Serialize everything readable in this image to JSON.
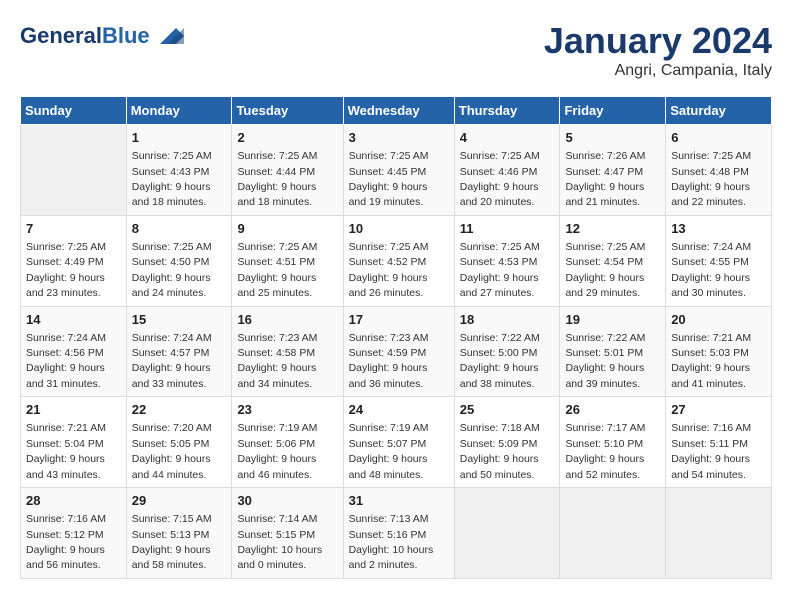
{
  "header": {
    "logo_line1": "General",
    "logo_line2": "Blue",
    "month": "January 2024",
    "location": "Angri, Campania, Italy"
  },
  "days_of_week": [
    "Sunday",
    "Monday",
    "Tuesday",
    "Wednesday",
    "Thursday",
    "Friday",
    "Saturday"
  ],
  "weeks": [
    [
      {
        "num": "",
        "info": ""
      },
      {
        "num": "1",
        "info": "Sunrise: 7:25 AM\nSunset: 4:43 PM\nDaylight: 9 hours\nand 18 minutes."
      },
      {
        "num": "2",
        "info": "Sunrise: 7:25 AM\nSunset: 4:44 PM\nDaylight: 9 hours\nand 18 minutes."
      },
      {
        "num": "3",
        "info": "Sunrise: 7:25 AM\nSunset: 4:45 PM\nDaylight: 9 hours\nand 19 minutes."
      },
      {
        "num": "4",
        "info": "Sunrise: 7:25 AM\nSunset: 4:46 PM\nDaylight: 9 hours\nand 20 minutes."
      },
      {
        "num": "5",
        "info": "Sunrise: 7:26 AM\nSunset: 4:47 PM\nDaylight: 9 hours\nand 21 minutes."
      },
      {
        "num": "6",
        "info": "Sunrise: 7:25 AM\nSunset: 4:48 PM\nDaylight: 9 hours\nand 22 minutes."
      }
    ],
    [
      {
        "num": "7",
        "info": "Sunrise: 7:25 AM\nSunset: 4:49 PM\nDaylight: 9 hours\nand 23 minutes."
      },
      {
        "num": "8",
        "info": "Sunrise: 7:25 AM\nSunset: 4:50 PM\nDaylight: 9 hours\nand 24 minutes."
      },
      {
        "num": "9",
        "info": "Sunrise: 7:25 AM\nSunset: 4:51 PM\nDaylight: 9 hours\nand 25 minutes."
      },
      {
        "num": "10",
        "info": "Sunrise: 7:25 AM\nSunset: 4:52 PM\nDaylight: 9 hours\nand 26 minutes."
      },
      {
        "num": "11",
        "info": "Sunrise: 7:25 AM\nSunset: 4:53 PM\nDaylight: 9 hours\nand 27 minutes."
      },
      {
        "num": "12",
        "info": "Sunrise: 7:25 AM\nSunset: 4:54 PM\nDaylight: 9 hours\nand 29 minutes."
      },
      {
        "num": "13",
        "info": "Sunrise: 7:24 AM\nSunset: 4:55 PM\nDaylight: 9 hours\nand 30 minutes."
      }
    ],
    [
      {
        "num": "14",
        "info": "Sunrise: 7:24 AM\nSunset: 4:56 PM\nDaylight: 9 hours\nand 31 minutes."
      },
      {
        "num": "15",
        "info": "Sunrise: 7:24 AM\nSunset: 4:57 PM\nDaylight: 9 hours\nand 33 minutes."
      },
      {
        "num": "16",
        "info": "Sunrise: 7:23 AM\nSunset: 4:58 PM\nDaylight: 9 hours\nand 34 minutes."
      },
      {
        "num": "17",
        "info": "Sunrise: 7:23 AM\nSunset: 4:59 PM\nDaylight: 9 hours\nand 36 minutes."
      },
      {
        "num": "18",
        "info": "Sunrise: 7:22 AM\nSunset: 5:00 PM\nDaylight: 9 hours\nand 38 minutes."
      },
      {
        "num": "19",
        "info": "Sunrise: 7:22 AM\nSunset: 5:01 PM\nDaylight: 9 hours\nand 39 minutes."
      },
      {
        "num": "20",
        "info": "Sunrise: 7:21 AM\nSunset: 5:03 PM\nDaylight: 9 hours\nand 41 minutes."
      }
    ],
    [
      {
        "num": "21",
        "info": "Sunrise: 7:21 AM\nSunset: 5:04 PM\nDaylight: 9 hours\nand 43 minutes."
      },
      {
        "num": "22",
        "info": "Sunrise: 7:20 AM\nSunset: 5:05 PM\nDaylight: 9 hours\nand 44 minutes."
      },
      {
        "num": "23",
        "info": "Sunrise: 7:19 AM\nSunset: 5:06 PM\nDaylight: 9 hours\nand 46 minutes."
      },
      {
        "num": "24",
        "info": "Sunrise: 7:19 AM\nSunset: 5:07 PM\nDaylight: 9 hours\nand 48 minutes."
      },
      {
        "num": "25",
        "info": "Sunrise: 7:18 AM\nSunset: 5:09 PM\nDaylight: 9 hours\nand 50 minutes."
      },
      {
        "num": "26",
        "info": "Sunrise: 7:17 AM\nSunset: 5:10 PM\nDaylight: 9 hours\nand 52 minutes."
      },
      {
        "num": "27",
        "info": "Sunrise: 7:16 AM\nSunset: 5:11 PM\nDaylight: 9 hours\nand 54 minutes."
      }
    ],
    [
      {
        "num": "28",
        "info": "Sunrise: 7:16 AM\nSunset: 5:12 PM\nDaylight: 9 hours\nand 56 minutes."
      },
      {
        "num": "29",
        "info": "Sunrise: 7:15 AM\nSunset: 5:13 PM\nDaylight: 9 hours\nand 58 minutes."
      },
      {
        "num": "30",
        "info": "Sunrise: 7:14 AM\nSunset: 5:15 PM\nDaylight: 10 hours\nand 0 minutes."
      },
      {
        "num": "31",
        "info": "Sunrise: 7:13 AM\nSunset: 5:16 PM\nDaylight: 10 hours\nand 2 minutes."
      },
      {
        "num": "",
        "info": ""
      },
      {
        "num": "",
        "info": ""
      },
      {
        "num": "",
        "info": ""
      }
    ]
  ]
}
